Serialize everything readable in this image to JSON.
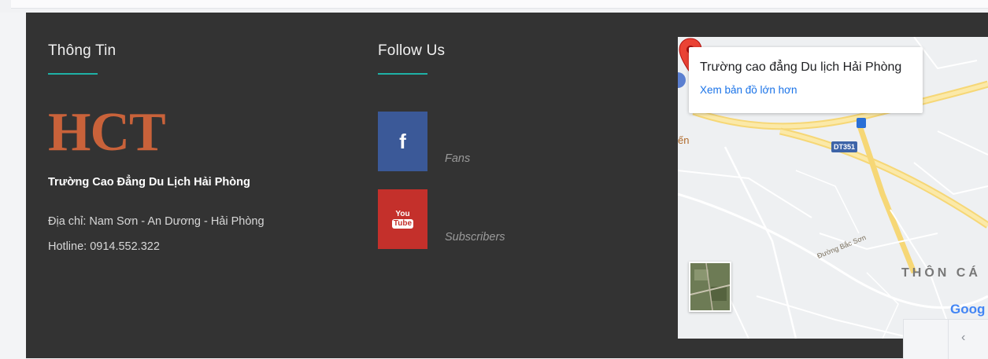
{
  "info": {
    "title": "Thông Tin",
    "logo_text": "HCT",
    "school_name": "Trường Cao Đẳng Du Lịch Hải Phòng",
    "address": "Địa chỉ: Nam Sơn - An Dương - Hải Phòng",
    "hotline": "Hotline: 0914.552.322"
  },
  "follow": {
    "title": "Follow Us",
    "facebook": {
      "icon": "facebook-icon",
      "label": "Fans",
      "color": "#3b5998"
    },
    "youtube": {
      "icon": "youtube-icon",
      "label": "Subscribers",
      "color": "#c4302b"
    }
  },
  "map": {
    "place_name": "Trường cao đẳng Du lịch Hải Phòng",
    "larger_map_link": "Xem bản đồ lớn hơn",
    "road_badge": "DT351",
    "road_label": "Đường Bắc Sơn",
    "area_label": "THÔN CÁ",
    "brand_label": "Goog",
    "left_fragment": "ến"
  },
  "colors": {
    "footer_bg": "#333333",
    "accent_teal": "#1fb2a6",
    "logo": "#c9623a"
  }
}
